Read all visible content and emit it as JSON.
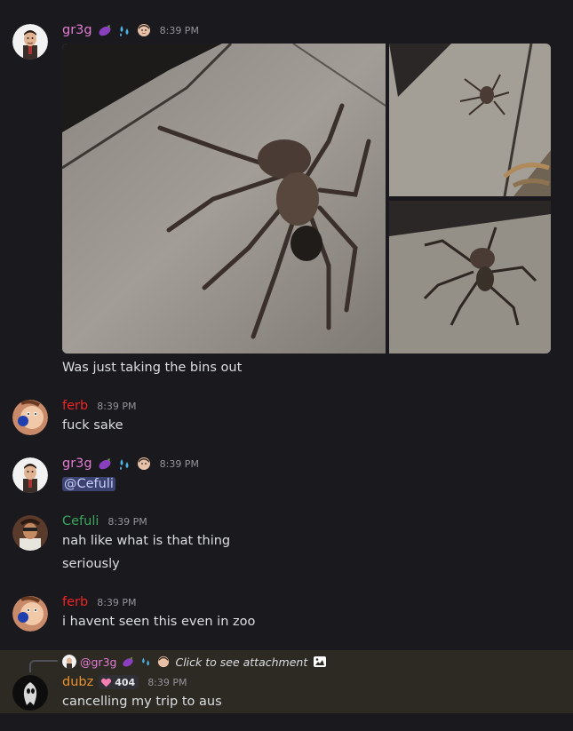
{
  "colors": {
    "background": "#1a1a1e",
    "highlight_bg": "#2c2a22",
    "gr3g": "#e27bd3",
    "ferb": "#ee2424",
    "cefuli": "#3ba55d",
    "dubz": "#e8932d"
  },
  "messages": [
    {
      "user": "gr3g",
      "time": "8:39 PM",
      "emojis": [
        "eggplant-emoji",
        "sweat-droplets-emoji",
        "man-face-emoji"
      ],
      "text": "Was just taking the bins out",
      "attachments": [
        "spider-photo-main",
        "spider-photo-top-right",
        "spider-photo-bottom-right"
      ]
    },
    {
      "user": "ferb",
      "time": "8:39 PM",
      "text": "fuck sake"
    },
    {
      "user": "gr3g",
      "time": "8:39 PM",
      "emojis": [
        "eggplant-emoji",
        "sweat-droplets-emoji",
        "man-face-emoji"
      ],
      "mention": "@Cefuli"
    },
    {
      "user": "Cefuli",
      "time": "8:39 PM",
      "lines": [
        "nah like what is that thing",
        "seriously"
      ]
    },
    {
      "user": "ferb",
      "time": "8:39 PM",
      "text": "i havent seen this even in zoo"
    },
    {
      "user": "dubz",
      "tag": "404",
      "time": "8:39 PM",
      "text": "cancelling my trip to aus",
      "reply": {
        "user": "@gr3g",
        "text": "Click to see attachment",
        "icon": "image-icon"
      }
    }
  ]
}
